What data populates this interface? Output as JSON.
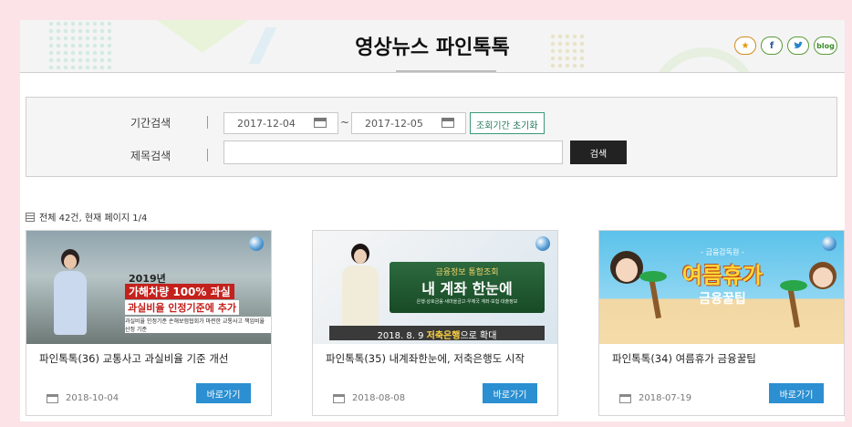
{
  "header": {
    "title": "영상뉴스 파인톡톡",
    "social": [
      {
        "icon": "star-icon",
        "glyph": "★"
      },
      {
        "icon": "facebook-icon",
        "glyph": "f"
      },
      {
        "icon": "twitter-icon",
        "glyph": "🐦"
      },
      {
        "icon": "blog-icon",
        "glyph": "blog"
      }
    ]
  },
  "search": {
    "period_label": "기간검색",
    "start_date": "2017-12-04",
    "tilde": "~",
    "end_date": "2017-12-05",
    "reset_label": "조회기간 초기화",
    "title_label": "제목검색",
    "title_value": "",
    "search_button": "검색"
  },
  "results": {
    "summary": "전체 42건, 현재 페이지 1/4"
  },
  "cards": [
    {
      "title": "파인톡톡(36) 교통사고 과실비율 기준 개선",
      "date": "2018-10-04",
      "button": "바로가기",
      "thumb": {
        "line1": "2019년",
        "line2": "가해차량 100% 과실",
        "line3": "과실비율 인정기준에 추가",
        "line4": "과실비율 인정기준  손해보험협회가 마련한 교통사고 책임비율 산정 기준"
      }
    },
    {
      "title": "파인톡톡(35) 내계좌한눈에, 저축은행도 시작",
      "date": "2018-08-08",
      "button": "바로가기",
      "thumb": {
        "line1": "금융정보 통합조회",
        "line2": "내 계좌 한눈에",
        "line3": "은행·상호금융·새마을금고·우체국 계좌·보험·대출정보",
        "ticker_pre": "2018. 8. 9 ",
        "ticker_hl": "저축은행",
        "ticker_post": "으로 확대"
      }
    },
    {
      "title": "파인톡톡(34) 여름휴가 금융꿀팁",
      "date": "2018-07-19",
      "button": "바로가기",
      "thumb": {
        "line1": "- 금융감독원 -",
        "line2": "여름휴가",
        "line3": "금융꿀팁"
      }
    }
  ],
  "colors": {
    "background": "#fbe3e8",
    "go_button": "#2b8fd1",
    "search_button": "#222222",
    "reset_border": "#3a9a7a"
  }
}
